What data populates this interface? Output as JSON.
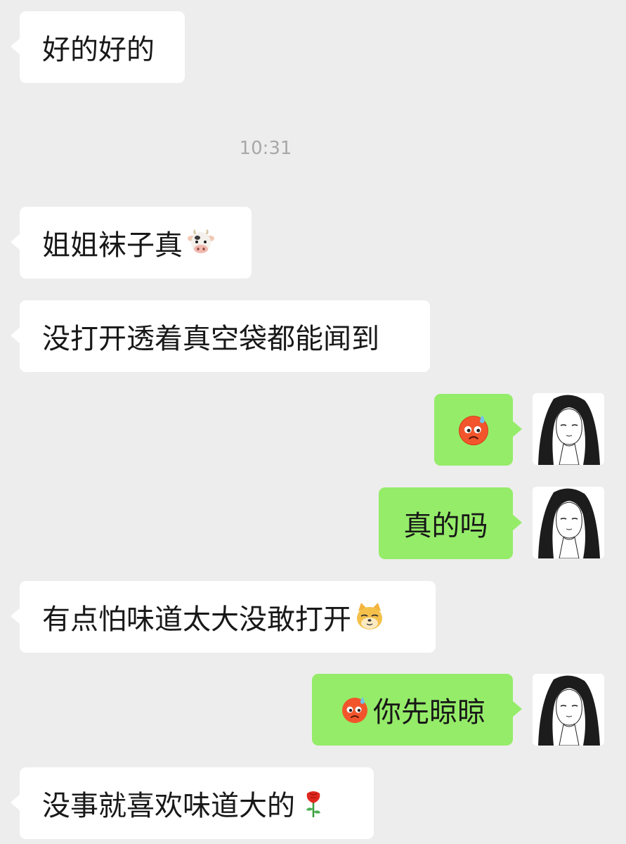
{
  "conversation": {
    "timestamp": "10:31",
    "messages": [
      {
        "side": "in",
        "text": "好的好的",
        "emoji": ""
      },
      {
        "side": "in",
        "text": "姐姐袜子真",
        "emoji": "cow-face-icon"
      },
      {
        "side": "in",
        "text": "没打开透着真空袋都能闻到",
        "emoji": ""
      },
      {
        "side": "out",
        "text": "",
        "emoji": "sweat-face-icon"
      },
      {
        "side": "out",
        "text": "真的吗",
        "emoji": ""
      },
      {
        "side": "in",
        "text": "有点怕味道太大没敢打开",
        "emoji": "doge-face-icon"
      },
      {
        "side": "out",
        "text": "你先晾晾",
        "emoji": "sweat-face-icon"
      },
      {
        "side": "in",
        "text": "没事就喜欢味道大的",
        "emoji": "rose-icon"
      }
    ]
  },
  "avatar": {
    "icon": "user-avatar-icon"
  }
}
